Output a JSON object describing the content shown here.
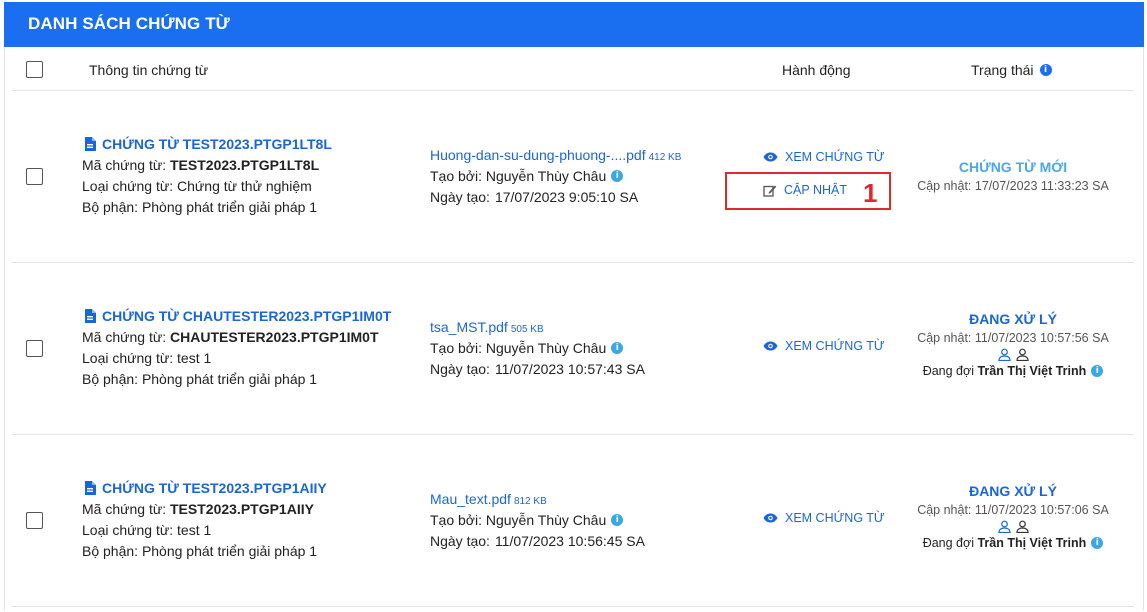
{
  "header": {
    "title": "DANH SÁCH CHỨNG TỪ"
  },
  "columns": {
    "info": "Thông tin chứng từ",
    "action": "Hành động",
    "status": "Trạng thái"
  },
  "labels": {
    "code": "Mã chứng từ: ",
    "type": "Loại chứng từ: ",
    "dept": "Bộ phận: ",
    "created_by": "Tạo bởi: ",
    "created_at": "Ngày tạo: ",
    "updated": "Cập nhật: ",
    "waiting": "Đang đợi "
  },
  "actions": {
    "view": "XEM CHỨNG TỪ",
    "update": "CẬP NHẬT"
  },
  "annotation": {
    "step": "1"
  },
  "colors": {
    "primary": "#1a6ff0",
    "link": "#1a66d8",
    "status_new": "#4aa8e8",
    "highlight": "#e0282e"
  },
  "rows": [
    {
      "title": "CHỨNG TỪ TEST2023.PTGP1LT8L",
      "code": "TEST2023.PTGP1LT8L",
      "type": "Chứng từ thử nghiệm",
      "dept": "Phòng phát triển giải pháp 1",
      "file_name": "Huong-dan-su-dung-phuong-....pdf",
      "file_size": "412 KB",
      "created_by": "Nguyễn Thùy Châu",
      "created_at": "17/07/2023 9:05:10 SA",
      "status": "CHỨNG TỪ MỚI",
      "updated": "17/07/2023 11:33:23 SA"
    },
    {
      "title": "CHỨNG TỪ CHAUTESTER2023.PTGP1IM0T",
      "code": "CHAUTESTER2023.PTGP1IM0T",
      "type": "test 1",
      "dept": "Phòng phát triển giải pháp 1",
      "file_name": "tsa_MST.pdf",
      "file_size": "505 KB",
      "created_by": "Nguyễn Thùy Châu",
      "created_at": "11/07/2023 10:57:43 SA",
      "status": "ĐANG XỬ LÝ",
      "updated": "11/07/2023 10:57:56 SA",
      "waiting_for": "Trần Thị Việt Trinh"
    },
    {
      "title": "CHỨNG TỪ TEST2023.PTGP1AIIY",
      "code": "TEST2023.PTGP1AIIY",
      "type": "test 1",
      "dept": "Phòng phát triển giải pháp 1",
      "file_name": "Mau_text.pdf",
      "file_size": "812 KB",
      "created_by": "Nguyễn Thùy Châu",
      "created_at": "11/07/2023 10:56:45 SA",
      "status": "ĐANG XỬ LÝ",
      "updated": "11/07/2023 10:57:06 SA",
      "waiting_for": "Trần Thị Việt Trinh"
    }
  ]
}
